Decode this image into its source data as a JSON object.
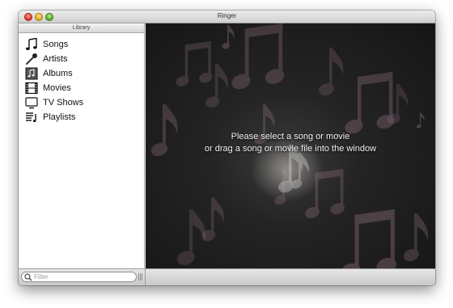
{
  "window": {
    "title": "Ringer"
  },
  "sidebar": {
    "header": "Library",
    "items": [
      {
        "label": "Songs",
        "icon": "music-note-icon"
      },
      {
        "label": "Artists",
        "icon": "microphone-icon"
      },
      {
        "label": "Albums",
        "icon": "album-icon"
      },
      {
        "label": "Movies",
        "icon": "film-icon"
      },
      {
        "label": "TV Shows",
        "icon": "tv-icon"
      },
      {
        "label": "Playlists",
        "icon": "playlist-icon"
      }
    ]
  },
  "bottombar": {
    "filter_placeholder": "Filter"
  },
  "content": {
    "message_line1": "Please select a song or movie",
    "message_line2": "or drag a song or movie file into the window"
  },
  "colors": {
    "content_background": "#1c1c1c",
    "note_tint": "#b48aa0"
  }
}
